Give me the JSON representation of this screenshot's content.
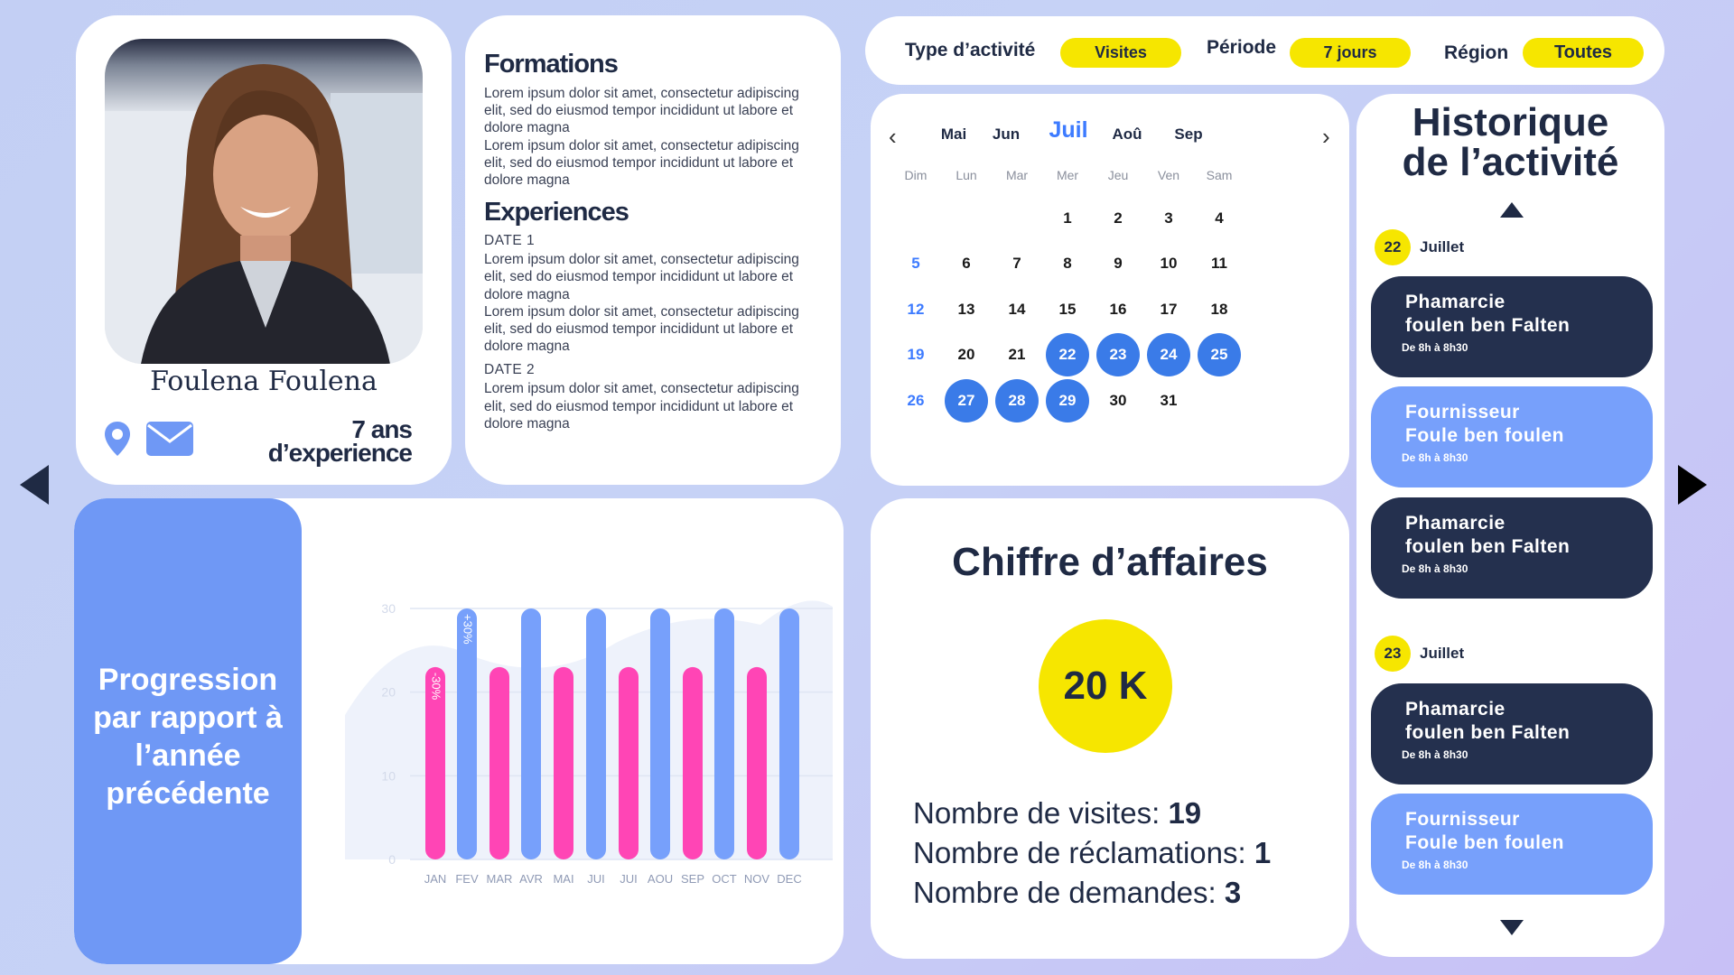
{
  "profile": {
    "name": "Foulena Foulena",
    "experience_line1": "7 ans",
    "experience_line2": "d’experience"
  },
  "resume": {
    "formations_title": "Formations",
    "formations_p1": "Lorem ipsum dolor sit amet, consectetur adipiscing elit, sed do eiusmod tempor incididunt ut labore et dolore magna",
    "formations_p2": "Lorem ipsum dolor sit amet, consectetur adipiscing elit, sed do eiusmod tempor incididunt ut labore et dolore magna",
    "experiences_title": "Experiences",
    "date1": "DATE 1",
    "exp_p1": "Lorem ipsum dolor sit amet, consectetur adipiscing elit, sed do eiusmod tempor incididunt ut labore et dolore magna",
    "exp_p2": "Lorem ipsum dolor sit amet, consectetur adipiscing elit, sed do eiusmod tempor incididunt ut labore et dolore magna",
    "date2": "DATE 2",
    "exp_p3": "Lorem ipsum dolor sit amet, consectetur adipiscing elit, sed do eiusmod tempor incididunt ut labore et dolore magna"
  },
  "filters": {
    "type_label": "Type d’activité",
    "type_value": "Visites",
    "period_label": "Période",
    "period_value": "7 jours",
    "region_label": "Région",
    "region_value": "Toutes"
  },
  "calendar": {
    "months": [
      "Mai",
      "Jun",
      "Juil",
      "Aoû",
      "Sep"
    ],
    "active_month": "Juil",
    "weekdays": [
      "Dim",
      "Lun",
      "Mar",
      "Mer",
      "Jeu",
      "Ven",
      "Sam"
    ],
    "first_weekday_index": 3,
    "days_in_month": 31,
    "selected_days": [
      22,
      23,
      24,
      25,
      27,
      28,
      29
    ]
  },
  "history": {
    "title_line1": "Historique",
    "title_line2": "de l’activité",
    "days": [
      {
        "num": "22",
        "month": "Juillet"
      },
      {
        "num": "23",
        "month": "Juillet"
      }
    ],
    "events": [
      {
        "line1": "Phamarcie",
        "line2": "foulen ben Falten",
        "time": "De 8h à 8h30",
        "style": "dark"
      },
      {
        "line1": "Fournisseur",
        "line2": "Foule ben foulen",
        "time": "De 8h à 8h30",
        "style": "blue"
      },
      {
        "line1": "Phamarcie",
        "line2": "foulen ben Falten",
        "time": "De 8h à 8h30",
        "style": "dark"
      },
      {
        "line1": "Phamarcie",
        "line2": "foulen ben Falten",
        "time": "De 8h à 8h30",
        "style": "dark"
      },
      {
        "line1": "Fournisseur",
        "line2": "Foule ben foulen",
        "time": "De 8h à 8h30",
        "style": "blue"
      }
    ]
  },
  "progression": {
    "title": "Progression par rapport à l’année précédente"
  },
  "revenue": {
    "title": "Chiffre d’affaires",
    "value": "20 K",
    "visits_label": "Nombre de visites: ",
    "visits_value": "19",
    "claims_label": "Nombre de réclamations: ",
    "claims_value": "1",
    "requests_label": "Nombre de demandes: ",
    "requests_value": "3"
  },
  "chart_data": {
    "type": "bar",
    "categories": [
      "JAN",
      "FEV",
      "MAR",
      "AVR",
      "MAI",
      "JUI",
      "JUI",
      "AOU",
      "SEP",
      "OCT",
      "NOV",
      "DEC"
    ],
    "series": [
      {
        "values": [
          23,
          23,
          23,
          23,
          23,
          23
        ],
        "color": "#ff45b5"
      },
      {
        "values": [
          30,
          30,
          30,
          30,
          30,
          30
        ],
        "color": "#77a0fb"
      }
    ],
    "bar_pattern": [
      "pink",
      "blue",
      "pink",
      "blue",
      "pink",
      "blue",
      "pink",
      "blue",
      "pink",
      "blue",
      "pink",
      "blue"
    ],
    "values": [
      23,
      30,
      23,
      30,
      23,
      30,
      23,
      30,
      23,
      30,
      23,
      30
    ],
    "y_ticks": [
      "0",
      "10",
      "20",
      "30"
    ],
    "ylim": [
      0,
      30
    ],
    "annotations": [
      {
        "category_index": 0,
        "text": "-30%"
      },
      {
        "category_index": 1,
        "text": "+30%"
      }
    ],
    "grid": true
  }
}
